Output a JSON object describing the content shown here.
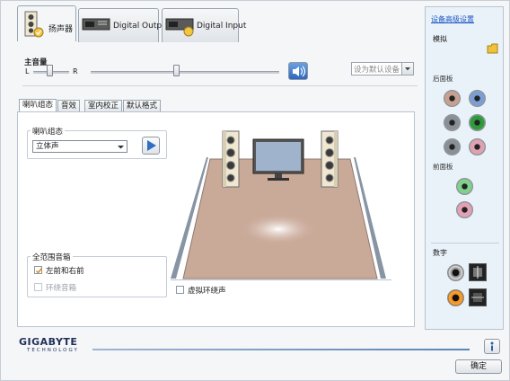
{
  "tabs": [
    {
      "label": "扬声器",
      "icon": "speaker-tab-icon"
    },
    {
      "label": "Digital Output",
      "icon": "digital-output-tab-icon"
    },
    {
      "label": "Digital Input",
      "icon": "digital-input-tab-icon"
    }
  ],
  "sidebar": {
    "device_link": "设备高级设置",
    "analog_label": "模拟",
    "rear_label": "后面板",
    "front_label": "前面板",
    "digital_label": "数字",
    "rear_jacks": [
      "#c8a090",
      "#7a9ed6",
      "#8a8f96",
      "#2e9b3a",
      "#8a8f96",
      "#e0a2b2"
    ],
    "front_jacks": [
      "#7fd18c",
      "#e4a0b4"
    ]
  },
  "volume": {
    "title": "主音量",
    "left": "L",
    "right": "R",
    "balance_level": 0.45,
    "volume_level": 0.45,
    "default_device_placeholder": "设为默认设备"
  },
  "subtabs": [
    "喇叭组态",
    "音效",
    "室内校正",
    "默认格式"
  ],
  "config": {
    "group_label": "喇叭组态",
    "selected": "立体声",
    "fullrange_title": "全范围音箱",
    "front_lr": "左前和右前",
    "surround": "环绕音箱",
    "virtual_surround": "虚拟环绕声",
    "front_lr_checked": true
  },
  "footer": {
    "brand": "GIGABYTE",
    "tagline": "TECHNOLOGY",
    "ok": "确定",
    "info_icon": "info-icon"
  },
  "colors": {
    "accent": "#1a55c4",
    "floor": "#c9a998",
    "play": "#2d6fc7"
  }
}
